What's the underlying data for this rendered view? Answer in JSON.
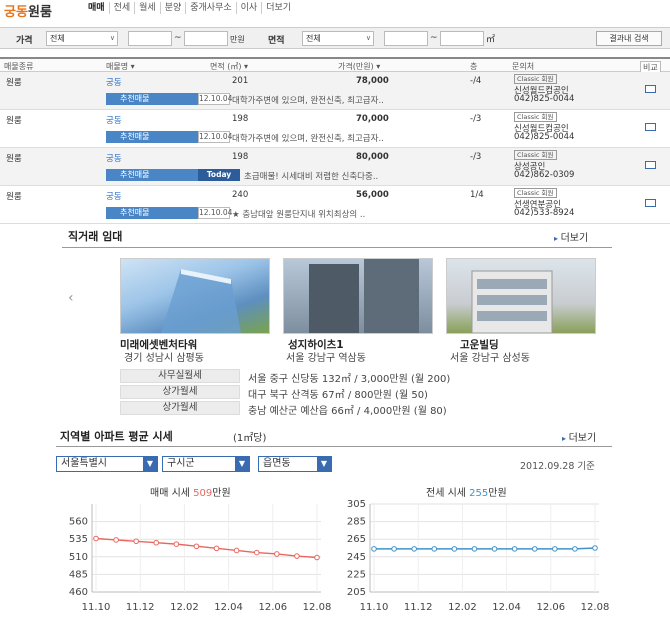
{
  "header": {
    "region": "궁동",
    "type": "원룸",
    "tabs": [
      "매매",
      "전세",
      "월세",
      "분양",
      "중개사무소",
      "이사",
      "더보기"
    ]
  },
  "filter": {
    "price_label": "가격",
    "price_select": "전체",
    "tilde": "~",
    "unit": "만원",
    "area_label": "면적",
    "area_select": "전체",
    "search_button": "결과내 검색"
  },
  "table": {
    "headers": [
      "매물종류",
      "매물명 ▾",
      "면적 (㎡) ▾",
      "가격(만원) ▾",
      "층",
      "문의처",
      "비교"
    ],
    "badge": "추천매물",
    "rows": [
      {
        "kind": "원룸",
        "name": "궁동",
        "area": "201",
        "price": "78,000",
        "floor": "-/4",
        "date": "12.10.04",
        "desc": "대학가주변에 있으며, 완전신축, 최고급자..",
        "classic": "Classic 회원",
        "agent": "신성월드컴공인",
        "phone": "042)825-0044"
      },
      {
        "kind": "원룸",
        "name": "궁동",
        "area": "198",
        "price": "70,000",
        "floor": "-/3",
        "date": "12.10.04",
        "desc": "대학가주변에 있으며, 완전신축, 최고급자..",
        "classic": "Classic 회원",
        "agent": "신성월드컴공인",
        "phone": "042)825-0044"
      },
      {
        "kind": "원룸",
        "name": "궁동",
        "area": "198",
        "price": "80,000",
        "floor": "-/3",
        "date": "Today",
        "desc": "초급매물! 시세대비 저렴한 신축다중..",
        "classic": "Classic 회원",
        "agent": "상성공인",
        "phone": "042)862-0309"
      },
      {
        "kind": "원룸",
        "name": "궁동",
        "area": "240",
        "price": "56,000",
        "floor": "1/4",
        "date": "12.10.04",
        "desc": "★ 충남대앞 원룸단지내 위치최상의 ..",
        "classic": "Classic 회원",
        "agent": "선생연분공인",
        "phone": "042)533-8924"
      }
    ]
  },
  "direct": {
    "title": "직거래 임대",
    "more": "더보기",
    "buildings": [
      {
        "name": "미래에셋벤처타워",
        "addr": "경기 성남시 삼평동"
      },
      {
        "name": "성지하이츠1",
        "addr": "서울 강남구 역삼동"
      },
      {
        "name": "고운빌딩",
        "addr": "서울 강남구 삼성동"
      }
    ],
    "listings": [
      {
        "cat": "사무실월세",
        "val": "서울 중구 신당동 132㎡ / 3,000만원 (월 200)"
      },
      {
        "cat": "상가월세",
        "val": "대구 북구 산격동 67㎡ / 800만원 (월 50)"
      },
      {
        "cat": "상가월세",
        "val": "충남 예산군 예산읍 66㎡ / 4,000만원 (월 80)"
      }
    ]
  },
  "region": {
    "title": "지역별 아파트 평균 시세",
    "unit": "(1㎡당)",
    "more": "더보기",
    "sido": "서울특별시",
    "sigungu": "구시군",
    "dong": "읍면동",
    "date": "2012.09.28 기준"
  },
  "chart_data": [
    {
      "type": "line",
      "title_prefix": "매매 시세 ",
      "title_value": "509",
      "title_suffix": "만원",
      "x": [
        "11.10",
        "11.12",
        "12.02",
        "12.04",
        "12.06",
        "12.08"
      ],
      "y_ticks": [
        "560",
        "535",
        "510",
        "485",
        "460"
      ],
      "ylim": [
        460,
        585
      ],
      "values": [
        536,
        534,
        532,
        530,
        528,
        525,
        522,
        519,
        516,
        514,
        511,
        509
      ],
      "color": "#e8675e"
    },
    {
      "type": "line",
      "title_prefix": "전세 시세 ",
      "title_value": "255",
      "title_suffix": "만원",
      "x": [
        "11.10",
        "11.12",
        "12.02",
        "12.04",
        "12.06",
        "12.08"
      ],
      "y_ticks": [
        "305",
        "285",
        "265",
        "245",
        "225",
        "205"
      ],
      "ylim": [
        205,
        305
      ],
      "values": [
        254,
        254,
        254,
        254,
        254,
        254,
        254,
        254,
        254,
        254,
        254,
        255
      ],
      "color": "#3f93c9"
    }
  ]
}
